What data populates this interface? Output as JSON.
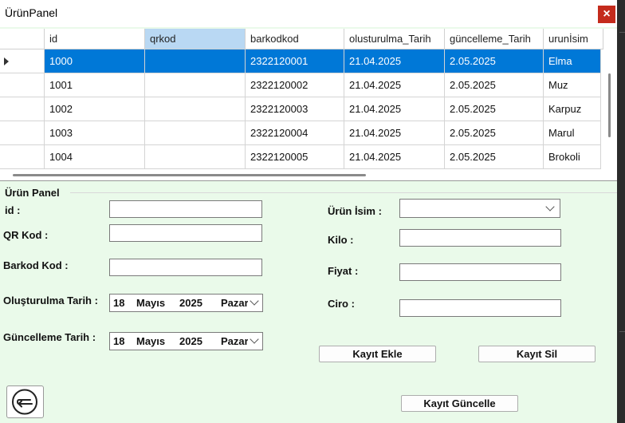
{
  "window": {
    "title": "ÜrünPanel",
    "close_label": "×"
  },
  "grid": {
    "columns": [
      "id",
      "qrkod",
      "barkodkod",
      "olusturulma_Tarih",
      "güncelleme_Tarih",
      "urunİsim"
    ],
    "selected_column": "qrkod",
    "rows": [
      {
        "id": "1000",
        "qrkod": "",
        "barkodkod": "2322120001",
        "olusturulma_Tarih": "21.04.2025",
        "guncelleme_Tarih": "2.05.2025",
        "urunIsim": "Elma",
        "selected": true
      },
      {
        "id": "1001",
        "qrkod": "",
        "barkodkod": "2322120002",
        "olusturulma_Tarih": "21.04.2025",
        "guncelleme_Tarih": "2.05.2025",
        "urunIsim": "Muz",
        "selected": false
      },
      {
        "id": "1002",
        "qrkod": "",
        "barkodkod": "2322120003",
        "olusturulma_Tarih": "21.04.2025",
        "guncelleme_Tarih": "2.05.2025",
        "urunIsim": "Karpuz",
        "selected": false
      },
      {
        "id": "1003",
        "qrkod": "",
        "barkodkod": "2322120004",
        "olusturulma_Tarih": "21.04.2025",
        "guncelleme_Tarih": "2.05.2025",
        "urunIsim": "Marul",
        "selected": false
      },
      {
        "id": "1004",
        "qrkod": "",
        "barkodkod": "2322120005",
        "olusturulma_Tarih": "21.04.2025",
        "guncelleme_Tarih": "2.05.2025",
        "urunIsim": "Brokoli",
        "selected": false
      }
    ]
  },
  "form": {
    "group_title": "Ürün Panel",
    "id_label": "id :",
    "qr_label": "QR Kod :",
    "barkod_label": "Barkod Kod :",
    "olusturulma_label": "Oluşturulma Tarih :",
    "guncelleme_label": "Güncelleme Tarih :",
    "urun_isim_label": "Ürün İsim :",
    "kilo_label": "Kilo :",
    "fiyat_label": "Fiyat :",
    "ciro_label": "Ciro :",
    "id_value": "",
    "qr_value": "",
    "barkod_value": "",
    "kilo_value": "",
    "fiyat_value": "",
    "ciro_value": "",
    "urun_isim_value": "",
    "olusturulma_date": {
      "day": "18",
      "month": "Mayıs",
      "year": "2025",
      "weekday": "Pazar"
    },
    "guncelleme_date": {
      "day": "18",
      "month": "Mayıs",
      "year": "2025",
      "weekday": "Pazar"
    }
  },
  "buttons": {
    "kayit_ekle": "Kayıt Ekle",
    "kayit_sil": "Kayıt Sil",
    "kayit_guncelle": "Kayıt Güncelle"
  },
  "colors": {
    "form_bg": "#eafaea",
    "selection": "#0078d7",
    "close": "#c42b1c"
  }
}
